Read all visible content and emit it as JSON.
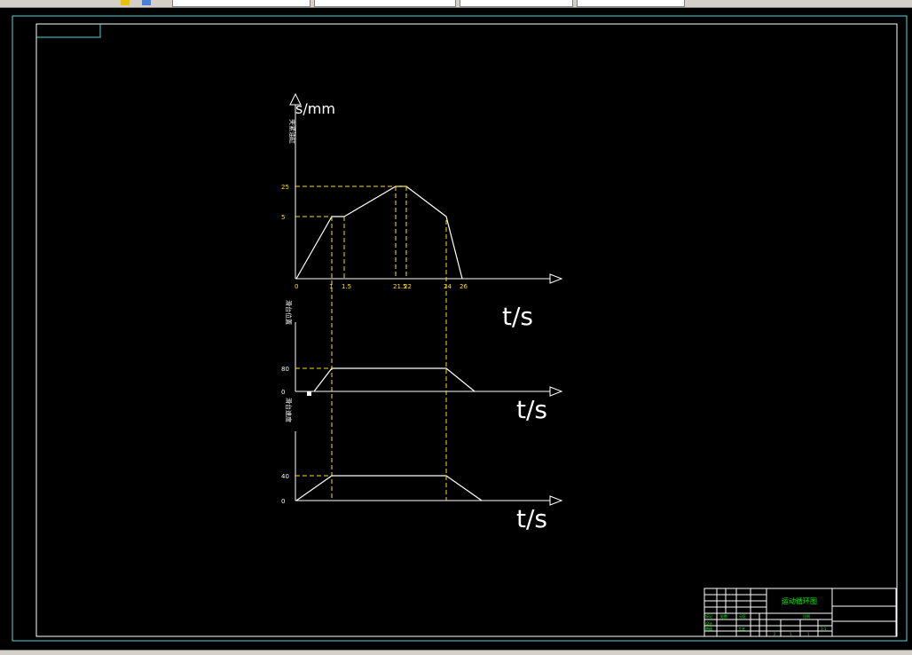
{
  "colors": {
    "background": "#000000",
    "line": "#ffffff",
    "dashed": "#ffe000",
    "tick_text": "#ffe000",
    "frame_outer": "#4fd8d8",
    "title_text": "#00ff00"
  },
  "toolbar": {
    "icons": [
      "layer-icon",
      "cube-icon"
    ]
  },
  "chart_data": [
    {
      "type": "line",
      "ylabel": "s/mm",
      "xlabel": "t/s",
      "y_side_label": "夹紧油缸",
      "x_ticks": [
        "0",
        "1",
        "1.5",
        "21.5",
        "22",
        "24",
        "26"
      ],
      "y_ticks": [
        "5",
        "25"
      ],
      "points": [
        {
          "x": 0,
          "y": 0
        },
        {
          "x": 1,
          "y": 5
        },
        {
          "x": 1.5,
          "y": 5
        },
        {
          "x": 21.5,
          "y": 25
        },
        {
          "x": 22,
          "y": 25
        },
        {
          "x": 24,
          "y": 5
        },
        {
          "x": 26,
          "y": 0
        }
      ]
    },
    {
      "type": "line",
      "xlabel": "t/s",
      "y_side_label": "滑台位置",
      "y_ticks": [
        "0",
        "80"
      ],
      "points": [
        {
          "x": 0.5,
          "y": 0
        },
        {
          "x": 1,
          "y": 80
        },
        {
          "x": 24,
          "y": 80
        },
        {
          "x": 26,
          "y": 0
        }
      ]
    },
    {
      "type": "line",
      "xlabel": "t/s",
      "y_side_label": "滑台速度",
      "y_ticks": [
        "0",
        "40"
      ],
      "points": [
        {
          "x": 0,
          "y": 0
        },
        {
          "x": 1,
          "y": 40
        },
        {
          "x": 24,
          "y": 40
        },
        {
          "x": 26,
          "y": 0
        }
      ]
    }
  ],
  "title_block": {
    "drawing_title": "运动循环图",
    "cells": [
      "标记",
      "处数",
      "分区",
      "设计",
      "审核",
      "工艺",
      "比例",
      "1:1",
      "2",
      "1",
      "1"
    ]
  }
}
